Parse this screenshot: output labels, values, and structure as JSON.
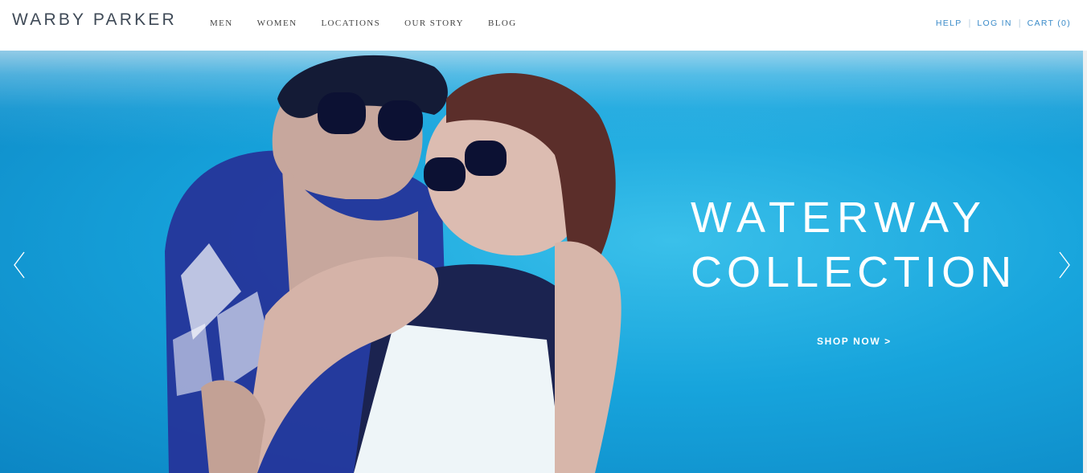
{
  "header": {
    "logo": "WARBY PARKER",
    "nav": [
      "MEN",
      "WOMEN",
      "LOCATIONS",
      "OUR STORY",
      "BLOG"
    ],
    "utility": [
      "HELP",
      "LOG IN",
      "CART (0)"
    ]
  },
  "hero": {
    "title_line1": "WATERWAY",
    "title_line2": "COLLECTION",
    "cta": "SHOP NOW >",
    "prev_icon": "chevron-left-icon",
    "next_icon": "chevron-right-icon"
  },
  "colors": {
    "logo": "#3f4a57",
    "utility_link": "#3a8bc9",
    "water": "#17a4dc"
  }
}
